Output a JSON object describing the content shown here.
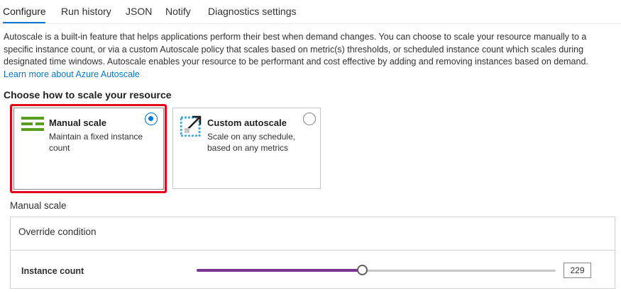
{
  "tabs": [
    {
      "label": "Configure",
      "active": true
    },
    {
      "label": "Run history",
      "active": false
    },
    {
      "label": "JSON",
      "active": false
    },
    {
      "label": "Notify",
      "active": false
    },
    {
      "label": "Diagnostics settings",
      "active": false
    }
  ],
  "description": {
    "text": "Autoscale is a built-in feature that helps applications perform their best when demand changes. You can choose to scale your resource manually to a specific instance count, or via a custom Autoscale policy that scales based on metric(s) thresholds, or scheduled instance count which scales during designated time windows. Autoscale enables your resource to be performant and cost effective by adding and removing instances based on demand.",
    "link": "Learn more about Azure Autoscale"
  },
  "section_title": "Choose how to scale your resource",
  "options": {
    "manual": {
      "title": "Manual scale",
      "subtitle": "Maintain a fixed instance count",
      "selected": true,
      "icon": "manual-scale-icon"
    },
    "custom": {
      "title": "Custom autoscale",
      "subtitle": "Scale on any schedule, based on any metrics",
      "selected": false,
      "icon": "custom-autoscale-icon"
    }
  },
  "manual_scale": {
    "label": "Manual scale",
    "override_condition": "Override condition",
    "instance_count_label": "Instance count",
    "instance_count": "229",
    "slider_fraction": 0.46
  },
  "colors": {
    "accent": "#0078d4",
    "slider_fill": "#7a3395",
    "highlight": "#e3001b",
    "manual_icon": "#5a9d1f",
    "custom_icon": "#3fa9dc"
  }
}
